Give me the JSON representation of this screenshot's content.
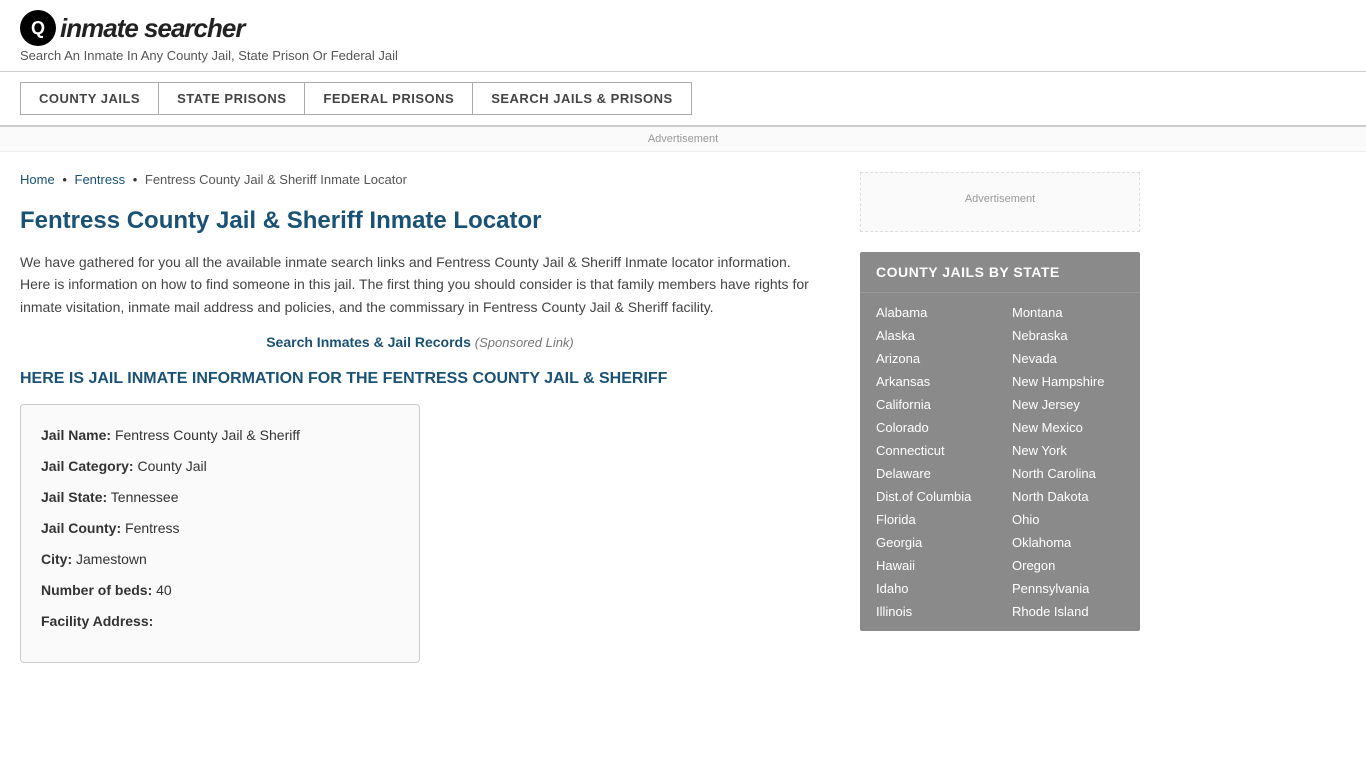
{
  "logo": {
    "icon_text": "Q",
    "text": "inmate searcher",
    "tagline": "Search An Inmate In Any County Jail, State Prison Or Federal Jail"
  },
  "nav": {
    "buttons": [
      {
        "label": "COUNTY JAILS",
        "name": "county-jails-btn"
      },
      {
        "label": "STATE PRISONS",
        "name": "state-prisons-btn"
      },
      {
        "label": "FEDERAL PRISONS",
        "name": "federal-prisons-btn"
      },
      {
        "label": "SEARCH JAILS & PRISONS",
        "name": "search-jails-btn"
      }
    ]
  },
  "ad_banner": "Advertisement",
  "breadcrumb": {
    "home": "Home",
    "sep1": "•",
    "fentress": "Fentress",
    "sep2": "•",
    "current": "Fentress County Jail & Sheriff Inmate Locator"
  },
  "page_title": "Fentress County Jail & Sheriff Inmate Locator",
  "description": "We have gathered for you all the available inmate search links and Fentress County Jail & Sheriff Inmate locator information. Here is information on how to find someone in this jail. The first thing you should consider is that family members have rights for inmate visitation, inmate mail address and policies, and the commissary in Fentress County Jail & Sheriff facility.",
  "sponsored": {
    "link_text": "Search Inmates & Jail Records",
    "suffix": "(Sponsored Link)"
  },
  "jail_info_header": "HERE IS JAIL INMATE INFORMATION FOR THE FENTRESS COUNTY JAIL & SHERIFF",
  "jail_info": {
    "name_label": "Jail Name:",
    "name_value": "Fentress County Jail & Sheriff",
    "category_label": "Jail Category:",
    "category_value": "County Jail",
    "state_label": "Jail State:",
    "state_value": "Tennessee",
    "county_label": "Jail County:",
    "county_value": "Fentress",
    "city_label": "City:",
    "city_value": "Jamestown",
    "beds_label": "Number of beds:",
    "beds_value": "40",
    "address_label": "Facility Address:"
  },
  "sidebar": {
    "ad_text": "Advertisement",
    "state_list_title": "COUNTY JAILS BY STATE",
    "states_left": [
      "Alabama",
      "Alaska",
      "Arizona",
      "Arkansas",
      "California",
      "Colorado",
      "Connecticut",
      "Delaware",
      "Dist.of Columbia",
      "Florida",
      "Georgia",
      "Hawaii",
      "Idaho",
      "Illinois"
    ],
    "states_right": [
      "Montana",
      "Nebraska",
      "Nevada",
      "New Hampshire",
      "New Jersey",
      "New Mexico",
      "New York",
      "North Carolina",
      "North Dakota",
      "Ohio",
      "Oklahoma",
      "Oregon",
      "Pennsylvania",
      "Rhode Island"
    ]
  }
}
